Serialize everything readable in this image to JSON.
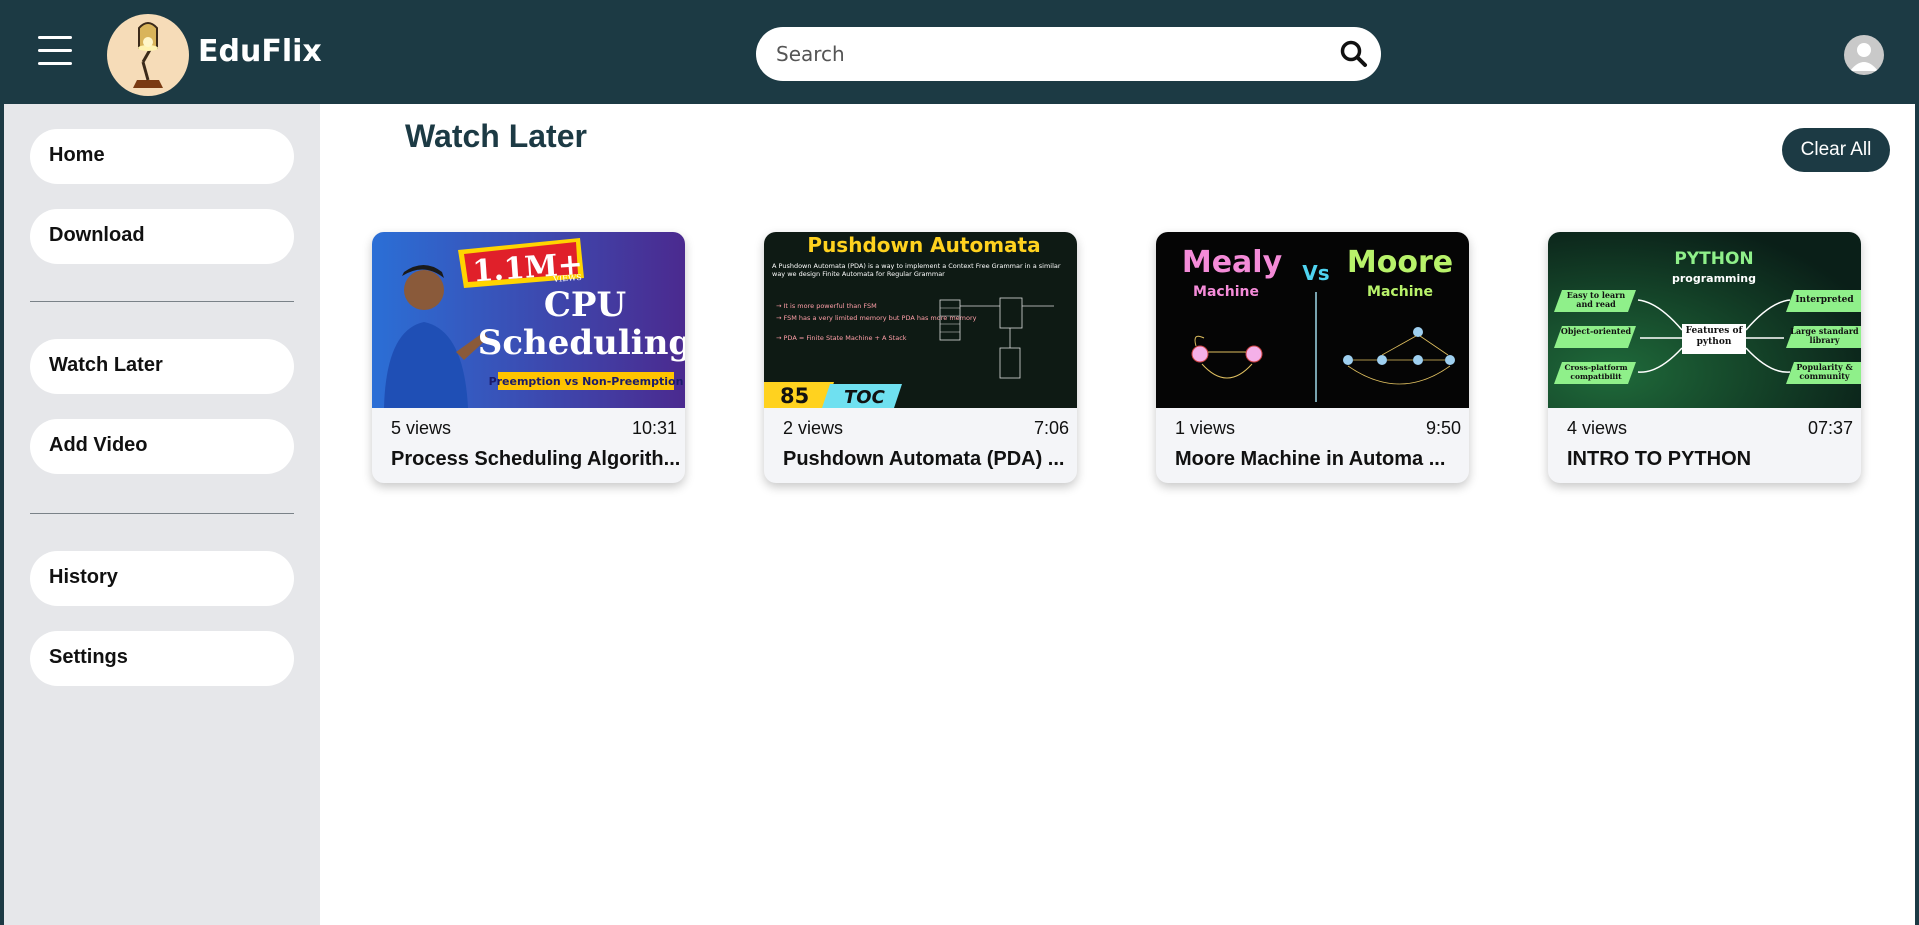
{
  "header": {
    "brand": "EduFlix",
    "search_placeholder": "Search"
  },
  "icons": {
    "menu": "hamburger-icon",
    "logo": "desk-lamp-icon",
    "search": "magnifier-icon",
    "avatar": "user-icon"
  },
  "colors": {
    "primary": "#1c3a44",
    "sidebar_bg": "#e6e7ea",
    "card_bg": "#f4f5f8"
  },
  "sidebar": {
    "items": [
      {
        "label": "Home"
      },
      {
        "label": "Download"
      },
      {
        "label": "Watch Later"
      },
      {
        "label": "Add Video"
      },
      {
        "label": "History"
      },
      {
        "label": "Settings"
      }
    ]
  },
  "main": {
    "title": "Watch Later",
    "clear_all": "Clear All"
  },
  "videos": [
    {
      "views": "5 views",
      "duration": "10:31",
      "title": "Process Scheduling Algorith...",
      "thumb": {
        "badge": "1.1M+",
        "badge_sub": "VIEWS",
        "line1": "CPU",
        "line2": "Scheduling",
        "tag": "Preemption vs Non-Preemption"
      }
    },
    {
      "views": "2 views",
      "duration": "7:06",
      "title": "Pushdown Automata (PDA) ...",
      "thumb": {
        "heading": "Pushdown Automata",
        "desc": "A Pushdown Automata (PDA) is a way to implement a Context Free Grammar in a similar way we design Finite Automata for Regular Grammar",
        "b1": "→ It is more powerful than FSM",
        "b2": "→ FSM has a very limited memory but PDA has more memory",
        "b3": "→ PDA = Finite State Machine + A Stack",
        "num": "85",
        "tag": "TOC"
      }
    },
    {
      "views": "1 views",
      "duration": "9:50",
      "title": "Moore Machine in Automa ...",
      "thumb": {
        "left": "Mealy",
        "left_sub": "Machine",
        "vs": "Vs",
        "right": "Moore",
        "right_sub": "Machine"
      }
    },
    {
      "views": "4 views",
      "duration": "07:37",
      "title": "INTRO TO PYTHON",
      "thumb": {
        "heading": "PYTHON",
        "sub": "programming",
        "center": "Features of python",
        "l1": "Easy to learn and read",
        "l2": "Object-oriented",
        "l3": "Cross-platform compatibilit",
        "r1": "Interpreted",
        "r2": "Large standard library",
        "r3": "Popularity & community"
      }
    }
  ]
}
